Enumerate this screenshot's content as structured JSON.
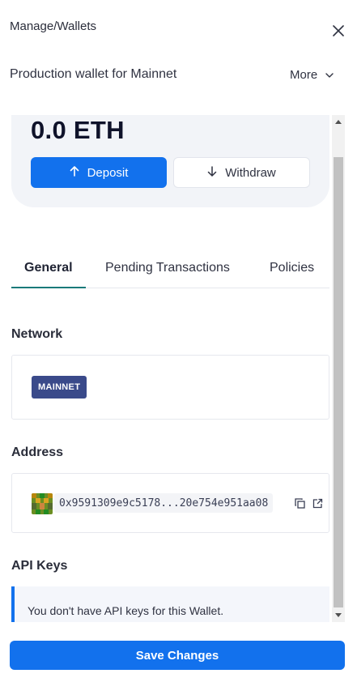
{
  "header": {
    "breadcrumb": "Manage/Wallets",
    "subtitle": "Production wallet for Mainnet",
    "more_label": "More"
  },
  "wallet": {
    "balance": "0.0 ETH",
    "deposit_label": "Deposit",
    "withdraw_label": "Withdraw"
  },
  "tabs": [
    {
      "label": "General",
      "active": true
    },
    {
      "label": "Pending Transactions",
      "active": false
    },
    {
      "label": "Policies",
      "active": false
    }
  ],
  "network": {
    "title": "Network",
    "badge": "MAINNET",
    "badge_color": "#3a4a8a"
  },
  "address": {
    "title": "Address",
    "value": "0x9591309e9c5178...20e754e951aa08",
    "icons": [
      "identicon",
      "copy-icon",
      "external-link-icon"
    ]
  },
  "api_keys": {
    "title": "API Keys",
    "empty_message": "You don't have API keys for this Wallet."
  },
  "footer": {
    "save_label": "Save Changes"
  },
  "colors": {
    "primary": "#1271ed",
    "tab_active_underline": "#1a7a7a",
    "card_bg": "#f2f4f8"
  }
}
